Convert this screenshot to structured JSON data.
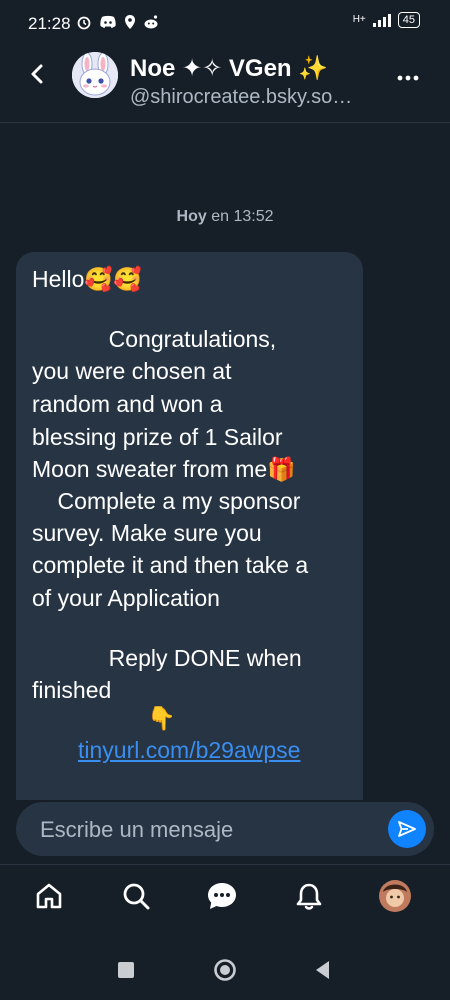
{
  "status_bar": {
    "time": "21:28",
    "network": "H+",
    "battery": "45",
    "icons": [
      "alarm-icon",
      "discord-icon",
      "location-icon",
      "reddit-icon",
      "signal-icon"
    ]
  },
  "header": {
    "contact_name": "Noe ✦✧ VGen ✨",
    "contact_handle": "@shirocreatee.bsky.so…"
  },
  "conversation": {
    "date_day": "Hoy",
    "date_time": "en 13:52",
    "message": {
      "lines": [
        "Hello🥰🥰",
        "            Congratulations,",
        "you were chosen at",
        "random and won a",
        "blessing prize of 1 Sailor",
        "Moon sweater from me🎁",
        "    Complete a my sponsor",
        "survey.  Make sure you",
        "complete it and then take a",
        "of your Application",
        "            Reply DONE when",
        "finished",
        "                  👇"
      ],
      "link": "tinyurl.com/b29awpse"
    }
  },
  "composer": {
    "placeholder": "Escribe un mensaje"
  },
  "tabs": [
    "home-icon",
    "search-icon",
    "chat-icon",
    "bell-icon",
    "profile-avatar"
  ],
  "colors": {
    "background": "#161e27",
    "bubble": "#263443",
    "accent": "#1083fe",
    "link": "#3a8ef0",
    "muted_text": "#aeb8c4"
  }
}
